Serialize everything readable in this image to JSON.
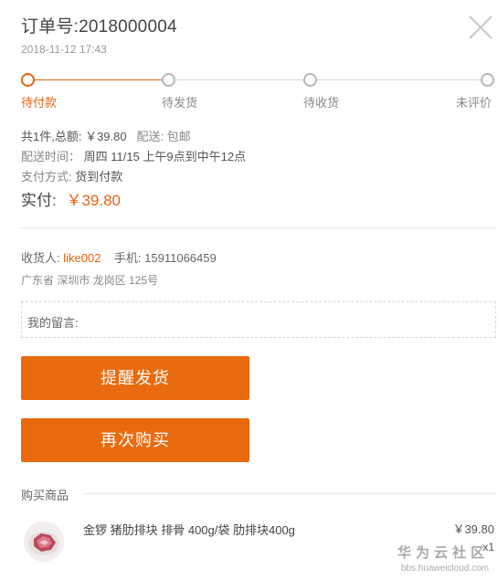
{
  "order": {
    "title": "订单号:2018000004",
    "time": "2018-11-12 17:43"
  },
  "progress": {
    "steps": [
      {
        "label": "待付款",
        "active": true
      },
      {
        "label": "待发货",
        "active": false
      },
      {
        "label": "待收货",
        "active": false
      },
      {
        "label": "未评价",
        "active": false
      }
    ]
  },
  "summary": {
    "total_line": "共1件,总额: ￥39.80",
    "shipping_label": "配送: 包邮",
    "delivery_label": "配送时间：",
    "delivery_value": "周四 11/15 上午9点到中午12点",
    "payment_label": "支付方式:",
    "payment_value": "货到付款",
    "paid_label": "实付:",
    "paid_amount": "￥39.80"
  },
  "receiver": {
    "name_label": "收货人:",
    "name": "like002",
    "phone_label": "手机:",
    "phone": "15911066459",
    "address": "广东省 深圳市 龙岗区 125号"
  },
  "message": {
    "label": "我的留言:"
  },
  "buttons": {
    "remind": "提醒发货",
    "rebuy": "再次购买"
  },
  "products_section": {
    "title": "购买商品",
    "items": [
      {
        "name": "金锣 猪肋排块 排骨 400g/袋 肋排块400g",
        "price": "￥39.80",
        "qty": "x1"
      }
    ]
  },
  "watermark": {
    "text": "华为云社区",
    "url": "bbs.huaweicloud.com"
  },
  "colors": {
    "accent": "#e8620f",
    "button": "#ea6a10"
  }
}
